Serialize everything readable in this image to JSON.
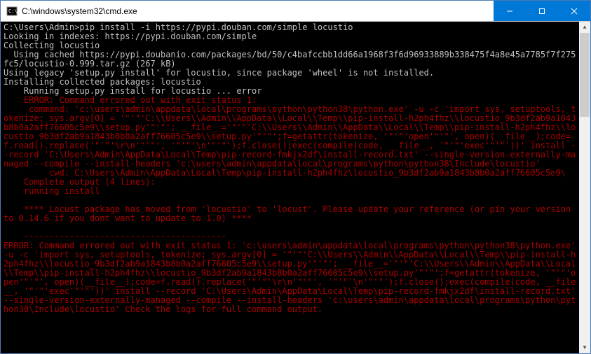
{
  "window": {
    "title": "C:\\windows\\system32\\cmd.exe"
  },
  "terminal": {
    "prompt": "C:\\Users\\Admin>",
    "command": "pip install -i https://pypi.douban.com/simple locustio",
    "lines": [
      "Looking in indexes: https://pypi.douban.com/simple",
      "Collecting locustio",
      "  Using cached https://pypi.doubanio.com/packages/bd/50/c4bafccbb1dd66a1968f3f6d96933889b338475f4a8e45a7785f7f275fc5/locustio-0.999.tar.gz (267 kB)",
      "Using legacy 'setup.py install' for locustio, since package 'wheel' is not installed.",
      "Installing collected packages: locustio",
      "    Running setup.py install for locustio ... error"
    ],
    "error_block": "    ERROR: Command errored out with exit status 1:\n     command: 'c:\\users\\admin\\appdata\\local\\programs\\python\\python38\\python.exe' -u -c 'import sys, setuptools, tokenize; sys.argv[0] = '\"'\"'C:\\\\Users\\\\Admin\\\\AppData\\\\Local\\\\Temp\\\\pip-install-h2ph4fhz\\\\locustio_9b3df2ab9a1843b8b0a2aff76605c5e9\\\\setup.py'\"'\"'; __file__='\"'\"'C:\\\\Users\\\\Admin\\\\AppData\\\\Local\\\\Temp\\\\pip-install-h2ph4fhz\\\\locustio_9b3df2ab9a1843b8b0a2aff76605c5e9\\\\setup.py'\"'\"';f=getattr(tokenize, '\"'\"'open'\"'\"', open)(__file__);code=f.read().replace('\"'\"'\\r\\n'\"'\"', '\"'\"'\\n'\"'\"');f.close();exec(compile(code, __file__, '\"'\"'exec'\"'\"'))' install --record 'C:\\Users\\Admin\\AppData\\Local\\Temp\\pip-record-fmkjx2df\\install-record.txt' --single-version-externally-managed --compile --install-headers 'c:\\users\\admin\\appdata\\local\\programs\\python\\python38\\Include\\locustio'\n         cwd: C:\\Users\\Admin\\AppData\\Local\\Temp\\pip-install-h2ph4fhz\\locustio_9b3df2ab9a1843b8b0a2aff76605c5e9\\\n    Complete output (4 lines):\n    running install\n\n    **** Locust package has moved from 'locustio' to 'locust'. Please update your reference (or pin your version to 0.14.6 if you dont want to update to 1.0) ****\n\n    ----------------------------------------",
    "error_summary": "ERROR: Command errored out with exit status 1: 'c:\\users\\admin\\appdata\\local\\programs\\python\\python38\\python.exe' -u -c 'import sys, setuptools, tokenize; sys.argv[0] = '\"'\"'C:\\\\Users\\\\Admin\\\\AppData\\\\Local\\\\Temp\\\\pip-install-h2ph4fhz\\\\locustio_9b3df2ab9a1843b8b0a2aff76605c5e9\\\\setup.py'\"'\"'; __file__='\"'\"'C:\\\\Users\\\\Admin\\\\AppData\\\\Local\\\\Temp\\\\pip-install-h2ph4fhz\\\\locustio_9b3df2ab9a1843b8b0a2aff76605c5e9\\\\setup.py'\"'\"';f=getattr(tokenize, '\"'\"'open'\"'\"', open)(__file__);code=f.read().replace('\"'\"'\\r\\n'\"'\"', '\"'\"'\\n'\"'\"');f.close();exec(compile(code, __file__, '\"'\"'exec'\"'\"'))' install --record 'C:\\Users\\Admin\\AppData\\Local\\Temp\\pip-record-fmkjx2df\\install-record.txt' --single-version-externally-managed --compile --install-headers 'c:\\users\\admin\\appdata\\local\\programs\\python\\python38\\Include\\locustio' Check the logs for full command output."
  }
}
